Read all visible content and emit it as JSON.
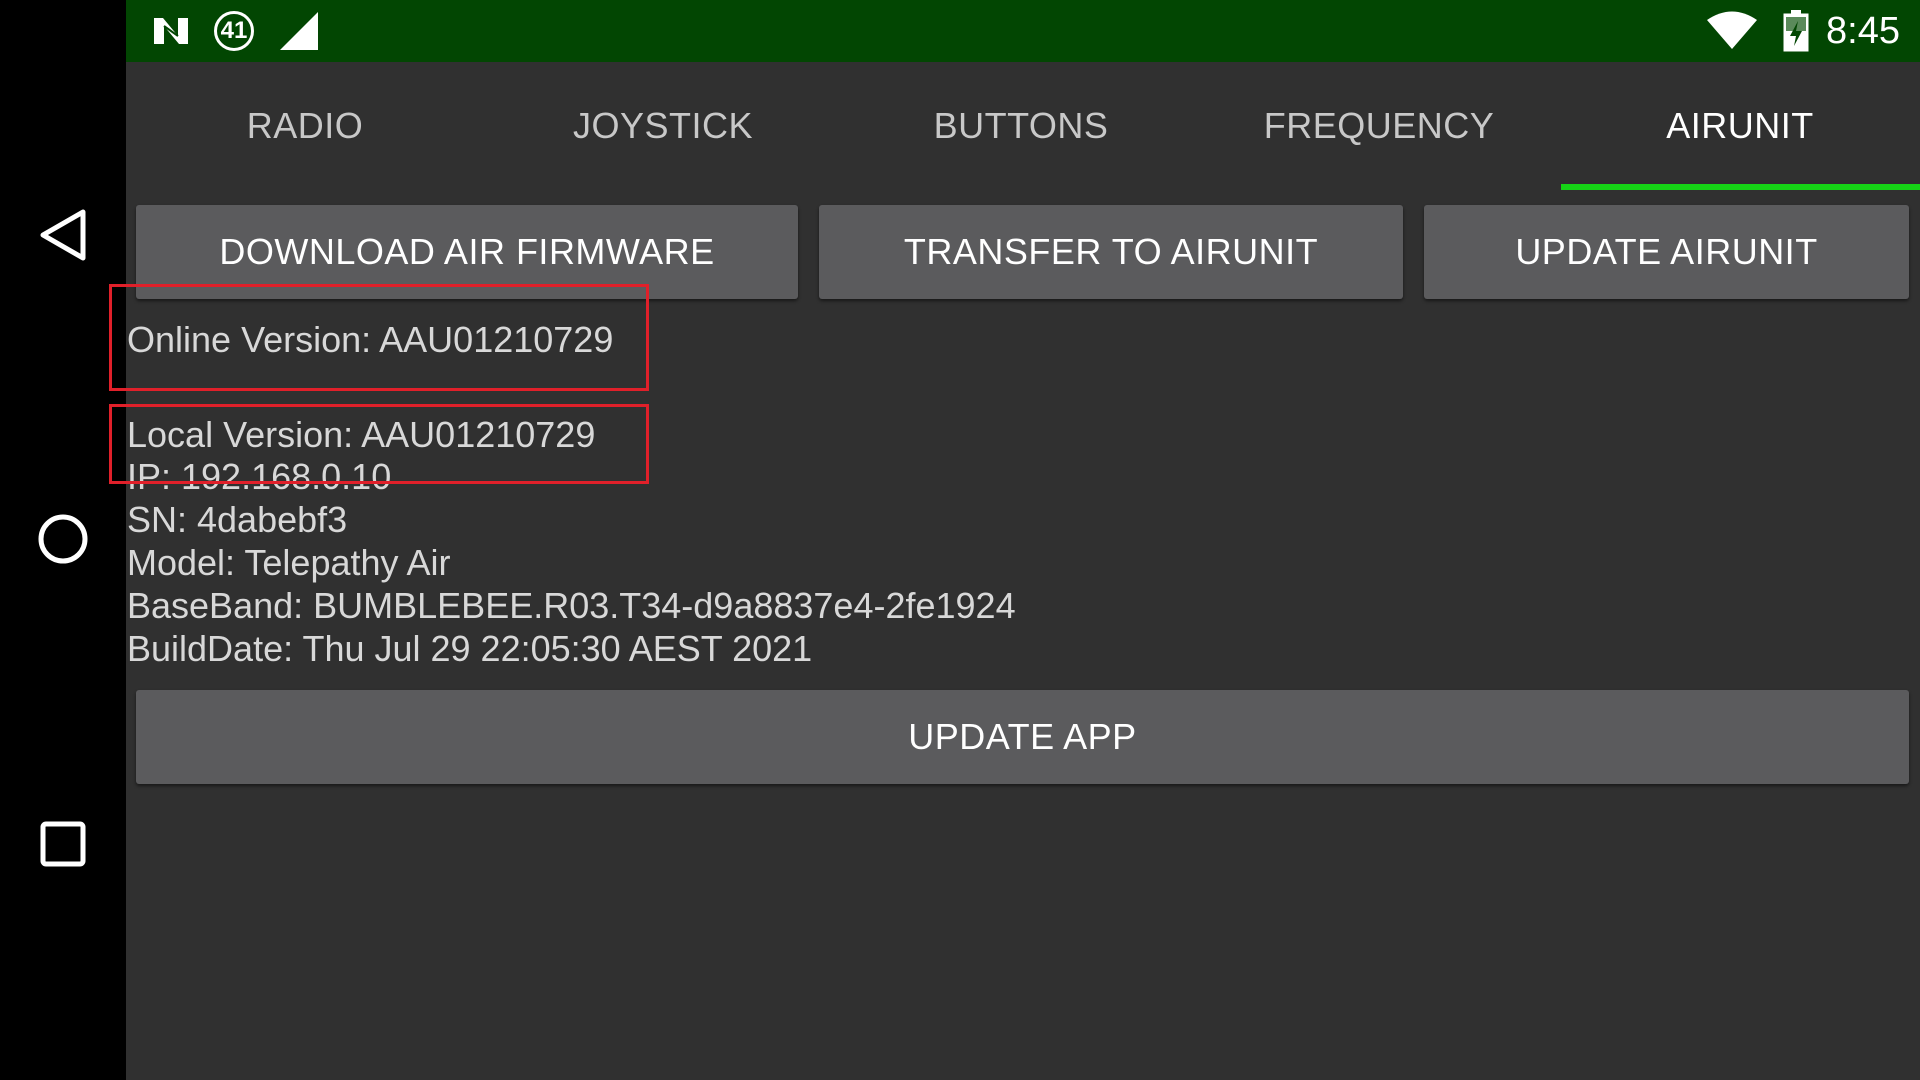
{
  "status_bar": {
    "time": "8:45",
    "notification_badge": "41",
    "icons": [
      "nfc-icon",
      "notification-badge-icon",
      "cell-signal-icon",
      "wifi-icon",
      "battery-charging-icon"
    ]
  },
  "nav_bar": {
    "icons": [
      "back-icon",
      "home-icon",
      "recents-icon"
    ]
  },
  "tabs": [
    {
      "label": "RADIO"
    },
    {
      "label": "JOYSTICK"
    },
    {
      "label": "BUTTONS"
    },
    {
      "label": "FREQUENCY"
    },
    {
      "label": "AIRUNIT",
      "active": true
    }
  ],
  "actions": {
    "download_label": "DOWNLOAD AIR FIRMWARE",
    "transfer_label": "TRANSFER TO AIRUNIT",
    "update_airunit_label": "UPDATE AIRUNIT",
    "update_app_label": "UPDATE APP"
  },
  "info": {
    "online_version": "Online Version: AAU01210729",
    "local_version": "Local Version: AAU01210729",
    "ip": "IP: 192.168.0.10",
    "sn": "SN: 4dabebf3",
    "model": "Model: Telepathy Air",
    "baseband": "BaseBand: BUMBLEBEE.R03.T34-d9a8837e4-2fe1924",
    "build_date": "BuildDate: Thu Jul 29 22:05:30 AEST 2021"
  },
  "colors": {
    "status_bar": "#024602",
    "background": "#303030",
    "button": "#5b5b5d",
    "tab_indicator": "#16d416",
    "highlight": "#e0202a"
  }
}
